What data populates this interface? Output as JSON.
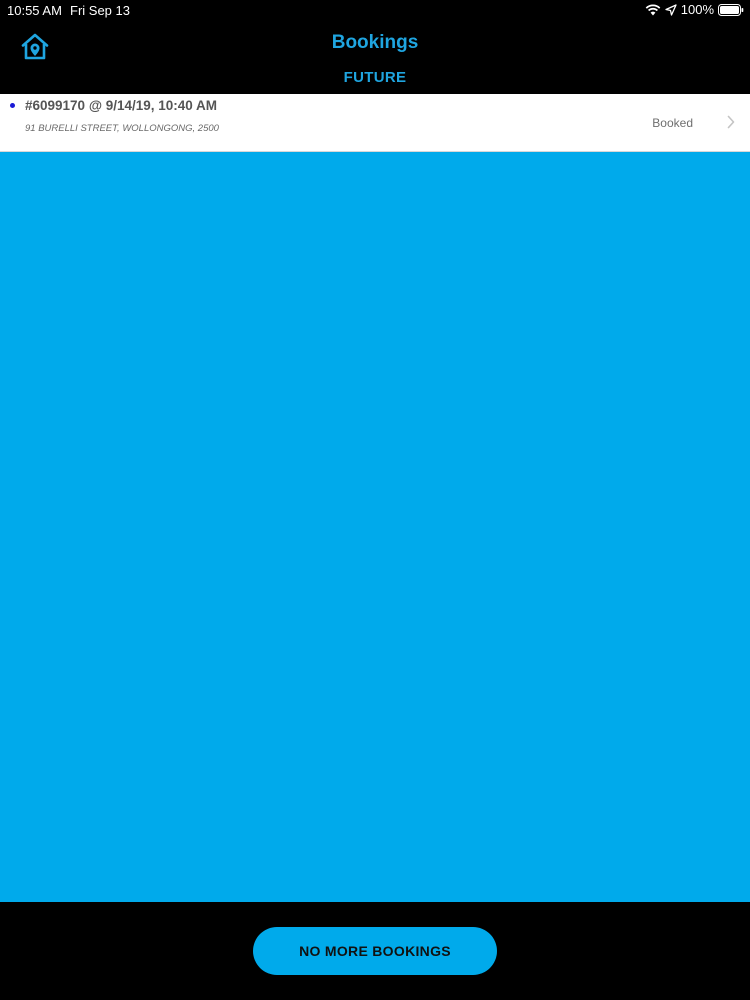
{
  "status_bar": {
    "time": "10:55 AM",
    "date": "Fri Sep 13",
    "battery": "100%",
    "icons": [
      "wifi-icon",
      "location-icon",
      "battery-icon"
    ]
  },
  "header": {
    "home_icon": "home-location-icon",
    "title": "Bookings",
    "subtitle": "FUTURE"
  },
  "bookings": [
    {
      "title": "#6099170 @ 9/14/19, 10:40 AM",
      "address": "91 BURELLI STREET, WOLLONGONG, 2500",
      "status": "Booked",
      "unread": true
    }
  ],
  "footer": {
    "button_label": "NO MORE BOOKINGS"
  },
  "colors": {
    "accent": "#1fa5e0",
    "content_bg": "#00aaeb",
    "unread_dot": "#1a1ad6",
    "background": "#000000"
  }
}
